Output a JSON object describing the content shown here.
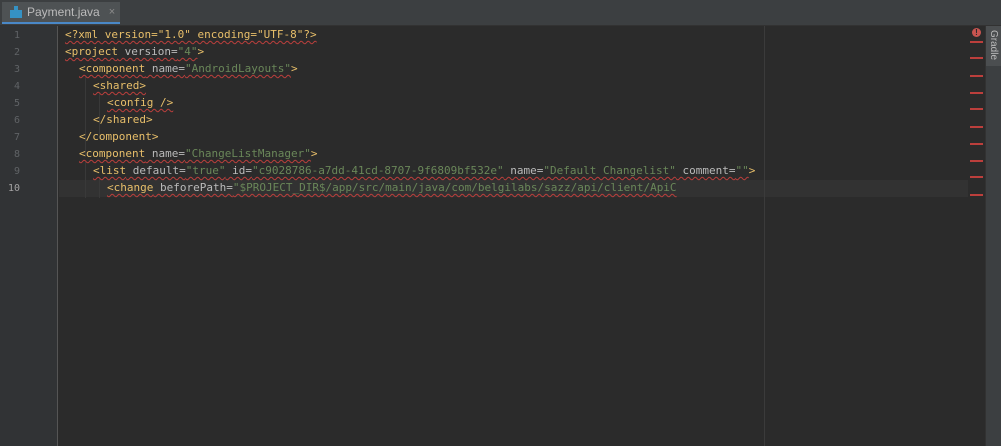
{
  "tab": {
    "filename": "Payment.java",
    "icon": "java-file-icon",
    "close": "×"
  },
  "side_panel": {
    "label": "Gradle"
  },
  "gutter": {
    "line_numbers": [
      "1",
      "2",
      "3",
      "4",
      "5",
      "6",
      "7",
      "8",
      "9",
      "10"
    ],
    "current_line": "10"
  },
  "error_marker": {
    "symbol": "!",
    "stripe_count": 11
  },
  "code": {
    "l1": {
      "text": "<?xml version=\"1.0\" encoding=\"UTF-8\"?>"
    },
    "l2": {
      "a": "<project",
      "b": " version=",
      "c": "\"4\"",
      "d": ">"
    },
    "l3": {
      "a": "<component",
      "b": " name=",
      "c": "\"AndroidLayouts\"",
      "d": ">"
    },
    "l4": {
      "a": "<shared>"
    },
    "l5": {
      "a": "<config />"
    },
    "l6": {
      "a": "</shared>"
    },
    "l7": {
      "a": "</component>"
    },
    "l8": {
      "a": "<component",
      "b": " name=",
      "c": "\"ChangeListManager\"",
      "d": ">"
    },
    "l9": {
      "a": "<list",
      "b": " default=",
      "c": "\"true\"",
      "d": " id=",
      "e": "\"c9028786-a7dd-41cd-8707-9f6809bf532e\"",
      "f": " name=",
      "g": "\"Default Changelist\"",
      "h": " comment=",
      "i": "\"\"",
      "j": ">"
    },
    "l10": {
      "a": "<change",
      "b": " beforePath=",
      "c": "\"$PROJECT_DIR$/app/src/main/java/com/belgilabs/sazz/api/client/ApiC"
    }
  },
  "colors": {
    "editor_bg": "#2b2b2b",
    "tag": "#e8bf6a",
    "attribute": "#bababa",
    "string": "#6a8759",
    "error": "#bc3f3c",
    "line_number": "#606366"
  }
}
